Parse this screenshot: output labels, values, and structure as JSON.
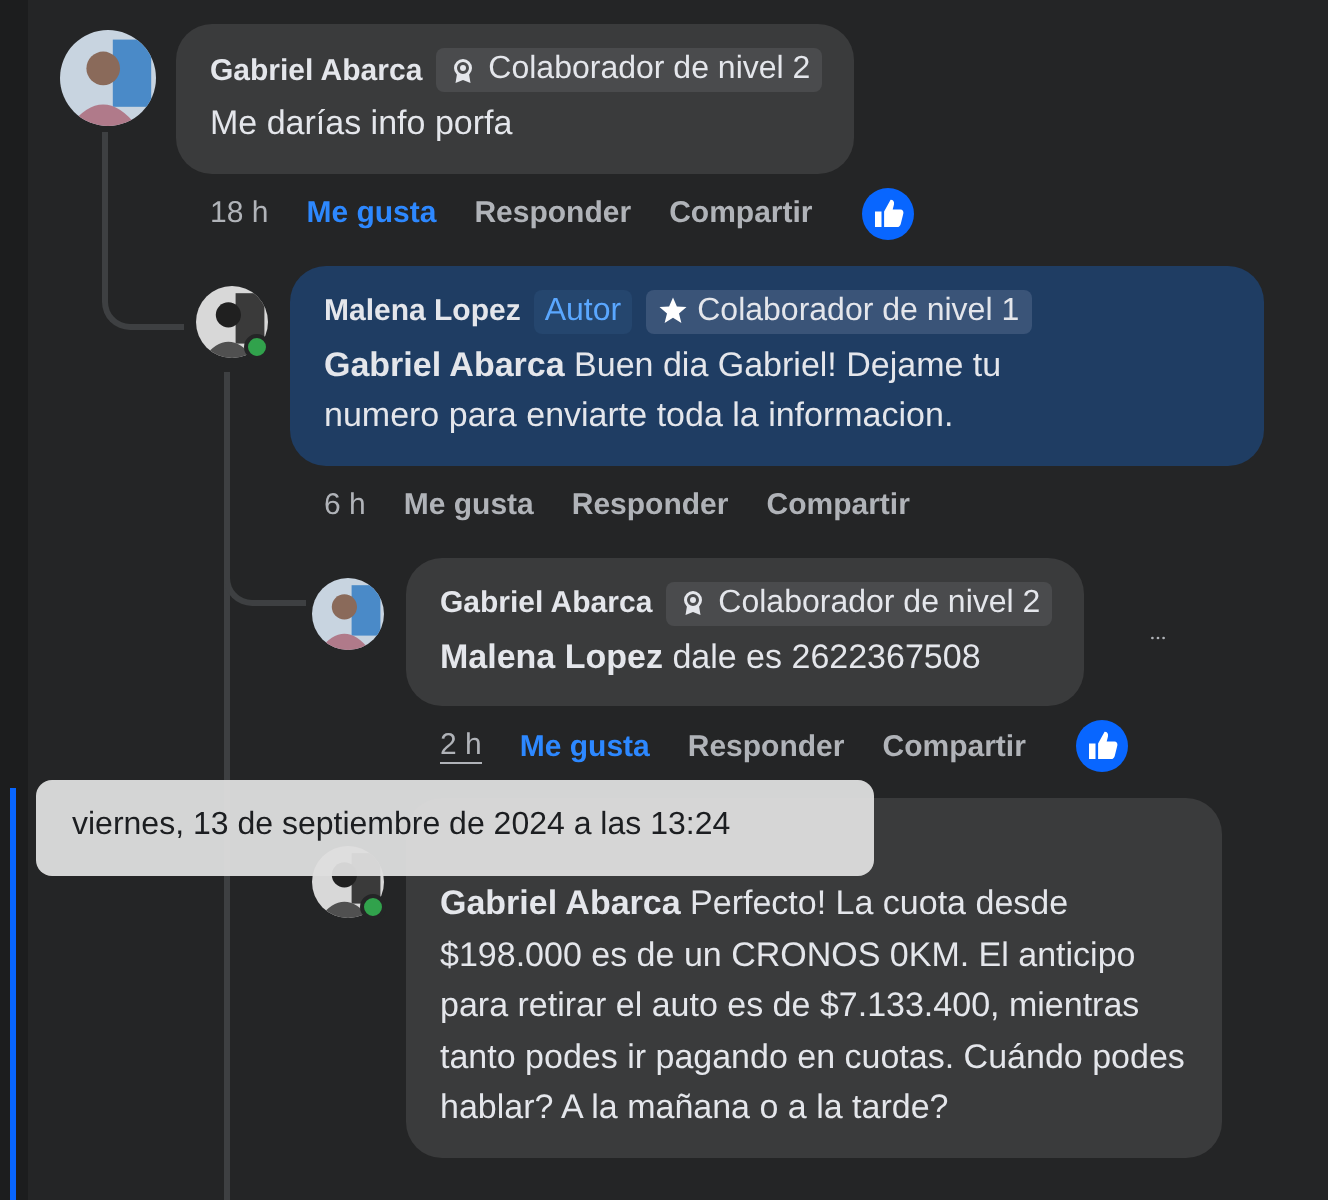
{
  "comments": [
    {
      "author": "Gabriel Abarca",
      "badge": {
        "kind": "award",
        "label": "Colaborador de nivel 2"
      },
      "text": "Me darías info porfa",
      "highlighted": false,
      "time": "18 h",
      "actions": [
        {
          "label": "Me gusta",
          "active": true
        },
        {
          "label": "Responder",
          "active": false
        },
        {
          "label": "Compartir",
          "active": false
        }
      ],
      "reacted": true,
      "children": [
        {
          "author": "Malena Lopez",
          "author_tag": "Autor",
          "badge": {
            "kind": "star",
            "label": "Colaborador de nivel 1"
          },
          "text": "**Gabriel Abarca** Buen dia Gabriel! Dejame tu numero para enviarte toda la informacion.",
          "highlighted": true,
          "online": true,
          "time": "6 h",
          "actions": [
            {
              "label": "Me gusta",
              "active": false
            },
            {
              "label": "Responder",
              "active": false
            },
            {
              "label": "Compartir",
              "active": false
            }
          ],
          "children": [
            {
              "author": "Gabriel Abarca",
              "badge": {
                "kind": "award",
                "label": "Colaborador de nivel 2"
              },
              "text": "**Malena Lopez** dale es 2622367508",
              "highlighted": false,
              "more_button": true,
              "time": "2 h",
              "time_hovered": true,
              "actions": [
                {
                  "label": "Me gusta",
                  "active": true
                },
                {
                  "label": "Responder",
                  "active": false
                },
                {
                  "label": "Compartir",
                  "active": false
                }
              ],
              "reacted": true
            },
            {
              "text": "**Gabriel Abarca** Perfecto! La cuota desde $198.000 es de un CRONOS 0KM. El anticipo para retirar el auto es de $7.133.400, mientras tanto podes ir pagando en cuotas. Cuándo podes hablar? A la mañana o a la tarde?",
              "highlighted": false,
              "focused": true,
              "online": true
            }
          ]
        }
      ]
    }
  ],
  "tooltip": {
    "text": "viernes, 13 de septiembre de 2024 a las 13:24"
  }
}
